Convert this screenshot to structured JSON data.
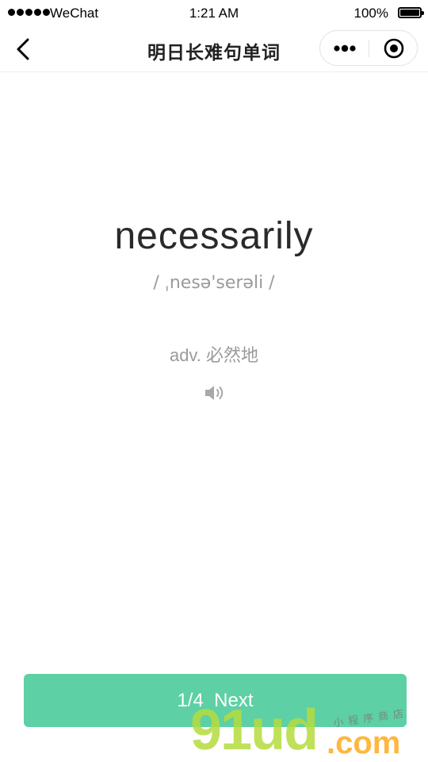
{
  "status_bar": {
    "carrier": "WeChat",
    "time": "1:21 AM",
    "battery": "100%",
    "battery_level": 1.0
  },
  "nav": {
    "back_icon": "chevron-left-icon",
    "title": "明日长难句单词",
    "menu_icon": "more-dots-icon",
    "close_icon": "target-circle-icon"
  },
  "card": {
    "word": "necessarily",
    "phonetic": "/ ˌnesə'serəli /",
    "definition": "adv. 必然地",
    "speaker_icon": "speaker-icon"
  },
  "footer": {
    "progress": "1/4",
    "next_label": "Next",
    "button_color": "#5dd0a5"
  },
  "watermark": {
    "brand": "91ud",
    "domain": ".com",
    "tagline": "小程序商店"
  }
}
